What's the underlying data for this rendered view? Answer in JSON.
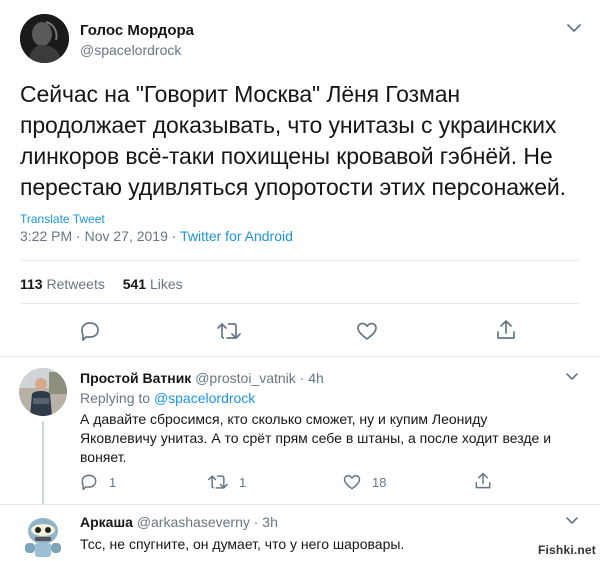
{
  "main_tweet": {
    "author_name": "Голос Мордора",
    "author_handle": "@spacelordrock",
    "text_lines": [
      "Сейчас на \"Говорит Москва\" Лёня Гозман",
      "продолжает доказывать, что унитазы с украинских",
      "линкоров всё-таки похищены кровавой гэбнёй. Не",
      "перестаю удивляться упоротости этих персонажей."
    ],
    "translate_label": "Translate Tweet",
    "timestamp": "3:22 PM · Nov 27, 2019 · ",
    "source": "Twitter for Android",
    "retweets_count": "113",
    "retweets_label": "Retweets",
    "likes_count": "541",
    "likes_label": "Likes"
  },
  "replies": [
    {
      "author_name": "Простой Ватник",
      "author_handle": "@prostoi_vatnik · 4h",
      "replying_prefix": "Replying to ",
      "replying_to": "@spacelordrock",
      "text_lines": [
        "А давайте сбросимся, кто сколько сможет, ну и купим Леониду",
        "Яковлевичу унитаз. А то срёт прям себе в штаны, а после ходит везде и",
        "воняет."
      ],
      "reply_count": "1",
      "retweet_count": "1",
      "like_count": "18"
    },
    {
      "author_name": "Аркаша",
      "author_handle": "@arkashaseverny · 3h",
      "text": "Тсс, не спугните, он думает, что у него шаровары."
    }
  ],
  "watermark": "Fishki.net",
  "colors": {
    "text": "#14171a",
    "secondary": "#657786",
    "link": "#1b95e0",
    "divider": "#e6ecf0"
  }
}
